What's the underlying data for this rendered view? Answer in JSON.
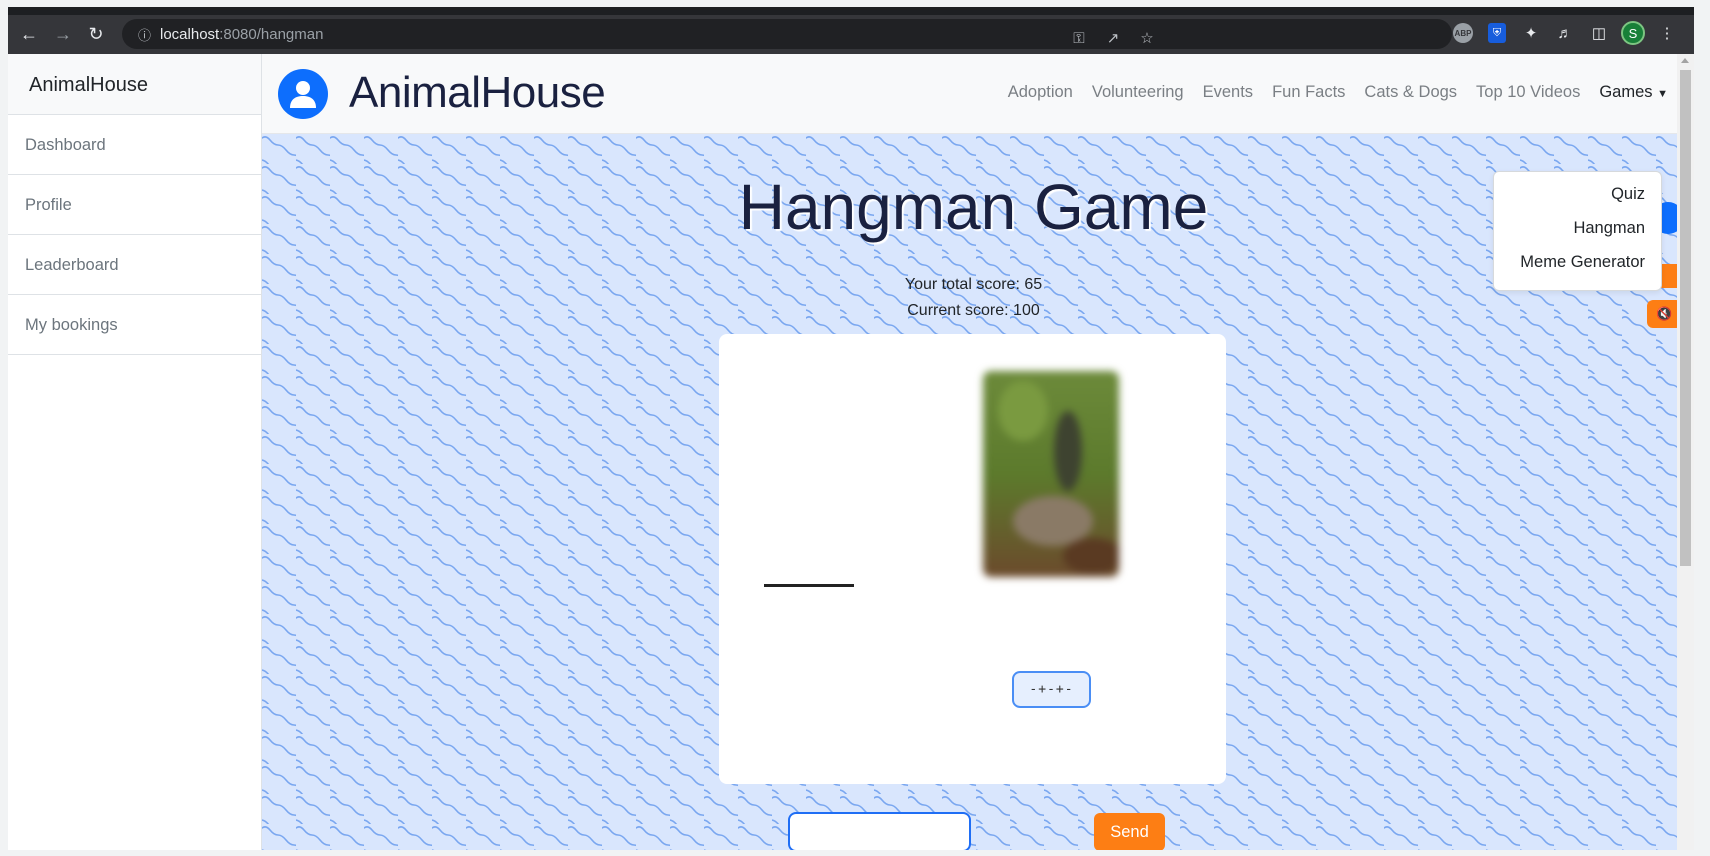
{
  "browser": {
    "url_host": "localhost",
    "url_path": ":8080/hangman",
    "profile_initial": "S",
    "abp_label": "ABP"
  },
  "sidebar": {
    "brand": "AnimalHouse",
    "items": [
      {
        "label": "Dashboard"
      },
      {
        "label": "Profile"
      },
      {
        "label": "Leaderboard"
      },
      {
        "label": "My bookings"
      }
    ]
  },
  "navbar": {
    "brand": "AnimalHouse",
    "links": [
      {
        "label": "Adoption"
      },
      {
        "label": "Volunteering"
      },
      {
        "label": "Events"
      },
      {
        "label": "Fun Facts"
      },
      {
        "label": "Cats & Dogs"
      },
      {
        "label": "Top 10 Videos"
      }
    ],
    "games_label": "Games",
    "games_menu": [
      {
        "label": "Quiz"
      },
      {
        "label": "Hangman"
      },
      {
        "label": "Meme Generator"
      }
    ]
  },
  "game": {
    "title": "Hangman Game",
    "total_score": "Your total score: 65",
    "current_score": "Current score: 100",
    "masked_word": "-+-+-",
    "guess_value": "",
    "send_label": "Send"
  },
  "colors": {
    "accent_blue": "#0d6efd",
    "accent_orange": "#fd7e14",
    "page_bg": "#d9e6fd",
    "wave": "#7aa7f0"
  }
}
